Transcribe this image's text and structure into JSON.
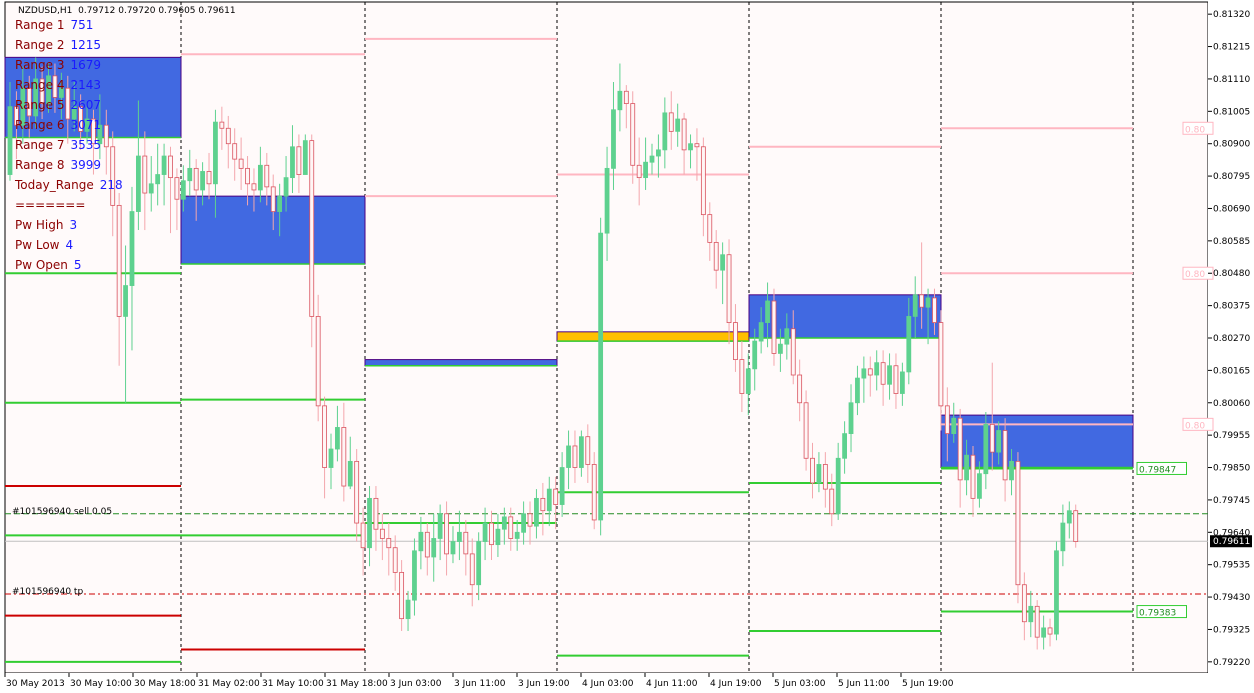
{
  "header": {
    "symbol": "NZDUSD,H1",
    "ohlc": "0.79712 0.79720 0.79605 0.79611"
  },
  "info_panel": {
    "rows": [
      {
        "label": "Range 1",
        "value": "751"
      },
      {
        "label": "Range 2",
        "value": "1215"
      },
      {
        "label": "Range 3",
        "value": "1679"
      },
      {
        "label": "Range 4",
        "value": "2143"
      },
      {
        "label": "Range 5",
        "value": "2607"
      },
      {
        "label": "Range 6",
        "value": "3071"
      },
      {
        "label": "Range 7",
        "value": "3535"
      },
      {
        "label": "Range 8",
        "value": "3999"
      },
      {
        "label": "Today_Range",
        "value": "218"
      },
      {
        "label": "=======",
        "value": ""
      },
      {
        "label": "Pw High",
        "value": "3"
      },
      {
        "label": "Pw Low",
        "value": "4"
      },
      {
        "label": "Pw Open",
        "value": "5"
      }
    ]
  },
  "orders": {
    "sell_label": "#101596940 sell 0.05",
    "tp_label": "#101596940 tp"
  },
  "colors": {
    "bull": "#5ed18f",
    "bear": "#f4a6ac",
    "zone": "#4169e1",
    "zone_highlight": "#ffc000",
    "support": "#32cd32",
    "resistance": "#ffb6c1",
    "tp": "#cc0000",
    "background": "#fffafa"
  },
  "chart_data": {
    "type": "candlestick",
    "symbol": "NZDUSD",
    "timeframe": "H1",
    "y_ticks": [
      "0.81320",
      "0.81215",
      "0.81110",
      "0.81005",
      "0.80900",
      "0.80795",
      "0.80690",
      "0.80585",
      "0.80480",
      "0.80375",
      "0.80270",
      "0.80165",
      "0.80060",
      "0.79955",
      "0.79850",
      "0.79745",
      "0.79640",
      "0.79535",
      "0.79430",
      "0.79325",
      "0.79220"
    ],
    "x_ticks": [
      "30 May 2013",
      "30 May 10:00",
      "30 May 18:00",
      "31 May 02:00",
      "31 May 10:00",
      "31 May 18:00",
      "3 Jun 03:00",
      "3 Jun 11:00",
      "3 Jun 19:00",
      "4 Jun 03:00",
      "4 Jun 11:00",
      "4 Jun 19:00",
      "5 Jun 03:00",
      "5 Jun 11:00",
      "5 Jun 19:00"
    ],
    "ylim": [
      0.792,
      0.8134
    ],
    "current_price": "0.79611",
    "price_tags": [
      {
        "text": "0.80",
        "price": 0.8095
      },
      {
        "text": "0.80",
        "price": 0.8048
      },
      {
        "text": "0.80",
        "price": 0.7999
      },
      {
        "text": "0.79847",
        "price": 0.79847
      },
      {
        "text": "0.79383",
        "price": 0.79383
      }
    ],
    "zones": [
      {
        "day": 0,
        "top": 0.8118,
        "bottom": 0.8092,
        "color": "zone"
      },
      {
        "day": 1,
        "top": 0.8073,
        "bottom": 0.8051,
        "color": "zone"
      },
      {
        "day": 2,
        "top": 0.802,
        "bottom": 0.8018,
        "color": "zone"
      },
      {
        "day": 3,
        "top": 0.8029,
        "bottom": 0.8026,
        "color": "zone_highlight"
      },
      {
        "day": 4,
        "top": 0.8041,
        "bottom": 0.8027,
        "color": "zone"
      },
      {
        "day": 5,
        "top": 0.8002,
        "bottom": 0.7985,
        "color": "zone"
      }
    ],
    "green_levels": [
      {
        "day": 0,
        "prices": [
          0.8048,
          0.8006,
          0.7963,
          0.7922
        ]
      },
      {
        "day": 1,
        "prices": [
          0.8007,
          0.7963
        ]
      },
      {
        "day": 2,
        "prices": [
          0.7967
        ]
      },
      {
        "day": 3,
        "prices": [
          0.7977,
          0.7924
        ]
      },
      {
        "day": 4,
        "prices": [
          0.798,
          0.7932
        ]
      },
      {
        "day": 5,
        "prices": [
          0.79847,
          0.79383
        ]
      }
    ],
    "pink_levels": [
      {
        "day": 1,
        "prices": [
          0.8119
        ]
      },
      {
        "day": 2,
        "prices": [
          0.8124,
          0.8073
        ]
      },
      {
        "day": 3,
        "prices": [
          0.808
        ]
      },
      {
        "day": 4,
        "prices": [
          0.8089
        ]
      },
      {
        "day": 5,
        "prices": [
          0.8095,
          0.8048,
          0.7999
        ]
      }
    ],
    "red_levels": [
      {
        "day": 0,
        "prices": [
          0.7979,
          0.7937
        ]
      },
      {
        "day": 1,
        "prices": [
          0.7926
        ]
      }
    ],
    "order_levels": {
      "sell": 0.797,
      "tp": 0.7944
    },
    "candles": [
      [
        0.808,
        0.8102,
        0.811,
        0.8078
      ],
      [
        0.8102,
        0.8096,
        0.8107,
        0.8085
      ],
      [
        0.8096,
        0.8108,
        0.8115,
        0.809
      ],
      [
        0.8108,
        0.8099,
        0.8112,
        0.8092
      ],
      [
        0.8099,
        0.8111,
        0.8118,
        0.8095
      ],
      [
        0.8111,
        0.8103,
        0.8115,
        0.8098
      ],
      [
        0.8103,
        0.8112,
        0.8116,
        0.81
      ],
      [
        0.8112,
        0.8105,
        0.8116,
        0.81
      ],
      [
        0.8105,
        0.8108,
        0.8113,
        0.8098
      ],
      [
        0.8108,
        0.8098,
        0.8112,
        0.809
      ],
      [
        0.8098,
        0.8102,
        0.811,
        0.8094
      ],
      [
        0.8102,
        0.8094,
        0.8106,
        0.8088
      ],
      [
        0.8094,
        0.8098,
        0.8103,
        0.809
      ],
      [
        0.8098,
        0.809,
        0.8101,
        0.808
      ],
      [
        0.809,
        0.8096,
        0.8106,
        0.8085
      ],
      [
        0.8096,
        0.8089,
        0.8101,
        0.808
      ],
      [
        0.8089,
        0.807,
        0.8094,
        0.806
      ],
      [
        0.807,
        0.8034,
        0.8074,
        0.8018
      ],
      [
        0.8034,
        0.8044,
        0.8057,
        0.8006
      ],
      [
        0.8044,
        0.8068,
        0.8076,
        0.8023
      ],
      [
        0.8068,
        0.8086,
        0.8104,
        0.8062
      ],
      [
        0.8086,
        0.8074,
        0.8094,
        0.8062
      ],
      [
        0.8074,
        0.8077,
        0.8086,
        0.8068
      ],
      [
        0.8077,
        0.808,
        0.809,
        0.807
      ],
      [
        0.808,
        0.8086,
        0.809,
        0.807
      ],
      [
        0.8086,
        0.8079,
        0.8089,
        0.8061
      ],
      [
        0.8079,
        0.8072,
        0.8082,
        0.8062
      ],
      [
        0.8072,
        0.8078,
        0.8083,
        0.8068
      ],
      [
        0.8078,
        0.8082,
        0.8088,
        0.8073
      ],
      [
        0.8082,
        0.8075,
        0.8085,
        0.8065
      ],
      [
        0.8075,
        0.8081,
        0.8084,
        0.807
      ],
      [
        0.8081,
        0.8077,
        0.8087,
        0.8072
      ],
      [
        0.8077,
        0.8097,
        0.8101,
        0.8066
      ],
      [
        0.8097,
        0.8095,
        0.8102,
        0.8088
      ],
      [
        0.8095,
        0.809,
        0.8099,
        0.8082
      ],
      [
        0.809,
        0.8085,
        0.8095,
        0.8078
      ],
      [
        0.8085,
        0.8082,
        0.8092,
        0.8075
      ],
      [
        0.8082,
        0.8077,
        0.8086,
        0.807
      ],
      [
        0.8077,
        0.8075,
        0.8082,
        0.8068
      ],
      [
        0.8075,
        0.8083,
        0.8089,
        0.8071
      ],
      [
        0.8083,
        0.8076,
        0.8087,
        0.807
      ],
      [
        0.8076,
        0.8068,
        0.808,
        0.8062
      ],
      [
        0.8068,
        0.8073,
        0.8077,
        0.806
      ],
      [
        0.8073,
        0.8079,
        0.8086,
        0.8068
      ],
      [
        0.8079,
        0.8089,
        0.8096,
        0.8074
      ],
      [
        0.8089,
        0.808,
        0.8093,
        0.8074
      ],
      [
        0.808,
        0.8091,
        0.8093,
        0.8082
      ],
      [
        0.8091,
        0.8034,
        0.8093,
        0.8024
      ],
      [
        0.8034,
        0.8005,
        0.8041,
        0.8
      ],
      [
        0.8005,
        0.7985,
        0.8008,
        0.7975
      ],
      [
        0.7985,
        0.7991,
        0.7996,
        0.7978
      ],
      [
        0.7991,
        0.7998,
        0.8005,
        0.7987
      ],
      [
        0.7998,
        0.7979,
        0.8006,
        0.7974
      ],
      [
        0.7979,
        0.7987,
        0.7995,
        0.7978
      ],
      [
        0.7987,
        0.7967,
        0.7991,
        0.7961
      ],
      [
        0.7967,
        0.7959,
        0.7972,
        0.795
      ],
      [
        0.7959,
        0.7975,
        0.7979,
        0.7953
      ],
      [
        0.7975,
        0.7965,
        0.7979,
        0.7958
      ],
      [
        0.7965,
        0.7962,
        0.797,
        0.7955
      ],
      [
        0.7962,
        0.7959,
        0.7967,
        0.795
      ],
      [
        0.7959,
        0.7951,
        0.7963,
        0.7945
      ],
      [
        0.7951,
        0.7936,
        0.7955,
        0.7932
      ],
      [
        0.7936,
        0.7942,
        0.7945,
        0.7932
      ],
      [
        0.7942,
        0.7958,
        0.7962,
        0.7937
      ],
      [
        0.7958,
        0.7964,
        0.7969,
        0.7952
      ],
      [
        0.7964,
        0.7956,
        0.7967,
        0.795
      ],
      [
        0.7956,
        0.7962,
        0.797,
        0.7948
      ],
      [
        0.7962,
        0.797,
        0.7973,
        0.7955
      ],
      [
        0.797,
        0.7957,
        0.7974,
        0.795
      ],
      [
        0.7957,
        0.7961,
        0.7966,
        0.7954
      ],
      [
        0.7961,
        0.7964,
        0.7971,
        0.7955
      ],
      [
        0.7964,
        0.7957,
        0.7968,
        0.795
      ],
      [
        0.7957,
        0.7947,
        0.7962,
        0.794
      ],
      [
        0.7947,
        0.7961,
        0.7964,
        0.7942
      ],
      [
        0.7961,
        0.7967,
        0.7972,
        0.7955
      ],
      [
        0.7967,
        0.796,
        0.7971,
        0.7955
      ],
      [
        0.796,
        0.7965,
        0.797,
        0.7956
      ],
      [
        0.7965,
        0.7969,
        0.7972,
        0.796
      ],
      [
        0.7969,
        0.7962,
        0.7972,
        0.7958
      ],
      [
        0.7962,
        0.7964,
        0.7968,
        0.7958
      ],
      [
        0.7964,
        0.797,
        0.7974,
        0.796
      ],
      [
        0.797,
        0.7966,
        0.7974,
        0.796
      ],
      [
        0.7966,
        0.7975,
        0.7978,
        0.7962
      ],
      [
        0.7975,
        0.7971,
        0.798,
        0.7963
      ],
      [
        0.7971,
        0.7978,
        0.7982,
        0.7966
      ],
      [
        0.7978,
        0.7973,
        0.7982,
        0.7965
      ],
      [
        0.7973,
        0.7985,
        0.799,
        0.7969
      ],
      [
        0.7985,
        0.7992,
        0.7997,
        0.7978
      ],
      [
        0.7992,
        0.7985,
        0.7997,
        0.798
      ],
      [
        0.7985,
        0.7995,
        0.7997,
        0.7982
      ],
      [
        0.7995,
        0.7986,
        0.7999,
        0.798
      ],
      [
        0.7986,
        0.7968,
        0.799,
        0.7965
      ],
      [
        0.7968,
        0.8061,
        0.8066,
        0.7963
      ],
      [
        0.8061,
        0.8082,
        0.8089,
        0.8052
      ],
      [
        0.8082,
        0.8101,
        0.811,
        0.8075
      ],
      [
        0.8101,
        0.8107,
        0.8116,
        0.8094
      ],
      [
        0.8107,
        0.8103,
        0.8109,
        0.8095
      ],
      [
        0.8103,
        0.8083,
        0.8107,
        0.8077
      ],
      [
        0.8083,
        0.8079,
        0.8092,
        0.807
      ],
      [
        0.8079,
        0.8084,
        0.8092,
        0.8075
      ],
      [
        0.8084,
        0.8086,
        0.809,
        0.808
      ],
      [
        0.8086,
        0.8088,
        0.8093,
        0.8079
      ],
      [
        0.8088,
        0.81,
        0.8105,
        0.8082
      ],
      [
        0.81,
        0.8094,
        0.8107,
        0.8088
      ],
      [
        0.8094,
        0.8098,
        0.8103,
        0.8089
      ],
      [
        0.8098,
        0.8088,
        0.81,
        0.808
      ],
      [
        0.8088,
        0.809,
        0.8093,
        0.8082
      ],
      [
        0.809,
        0.8089,
        0.8095,
        0.8078
      ],
      [
        0.8089,
        0.8067,
        0.8092,
        0.806
      ],
      [
        0.8067,
        0.8058,
        0.8071,
        0.8052
      ],
      [
        0.8058,
        0.8049,
        0.8062,
        0.8043
      ],
      [
        0.8049,
        0.8054,
        0.8058,
        0.8038
      ],
      [
        0.8054,
        0.8032,
        0.8059,
        0.8025
      ],
      [
        0.8032,
        0.802,
        0.8038,
        0.8016
      ],
      [
        0.802,
        0.8009,
        0.8026,
        0.8003
      ],
      [
        0.8009,
        0.8017,
        0.8022,
        0.8002
      ],
      [
        0.8017,
        0.8026,
        0.803,
        0.801
      ],
      [
        0.8026,
        0.8032,
        0.8037,
        0.8022
      ],
      [
        0.8032,
        0.8039,
        0.8045,
        0.8024
      ],
      [
        0.8039,
        0.8022,
        0.8043,
        0.8018
      ],
      [
        0.8022,
        0.8025,
        0.803,
        0.8016
      ],
      [
        0.8025,
        0.803,
        0.8035,
        0.802
      ],
      [
        0.803,
        0.8015,
        0.8036,
        0.8012
      ],
      [
        0.8015,
        0.8006,
        0.802,
        0.8
      ],
      [
        0.8006,
        0.7988,
        0.801,
        0.7984
      ],
      [
        0.7988,
        0.798,
        0.7993,
        0.7975
      ],
      [
        0.798,
        0.7986,
        0.799,
        0.7977
      ],
      [
        0.7986,
        0.7978,
        0.799,
        0.7972
      ],
      [
        0.7978,
        0.797,
        0.7983,
        0.7966
      ],
      [
        0.797,
        0.7988,
        0.7993,
        0.7968
      ],
      [
        0.7988,
        0.7996,
        0.8,
        0.7983
      ],
      [
        0.7996,
        0.8006,
        0.8012,
        0.799
      ],
      [
        0.8006,
        0.8014,
        0.8018,
        0.8002
      ],
      [
        0.8014,
        0.8017,
        0.8021,
        0.8006
      ],
      [
        0.8017,
        0.8015,
        0.8021,
        0.8008
      ],
      [
        0.8015,
        0.8019,
        0.8023,
        0.801
      ],
      [
        0.8019,
        0.8012,
        0.8023,
        0.8005
      ],
      [
        0.8012,
        0.8018,
        0.8022,
        0.8007
      ],
      [
        0.8018,
        0.8009,
        0.8022,
        0.8004
      ],
      [
        0.8009,
        0.8016,
        0.8019,
        0.8005
      ],
      [
        0.8016,
        0.8034,
        0.804,
        0.8012
      ],
      [
        0.8034,
        0.8041,
        0.8047,
        0.8027
      ],
      [
        0.8041,
        0.8037,
        0.8058,
        0.803
      ],
      [
        0.8037,
        0.804,
        0.8043,
        0.8025
      ],
      [
        0.804,
        0.8032,
        0.8043,
        0.8028
      ],
      [
        0.8032,
        0.8005,
        0.8036,
        0.7997
      ],
      [
        0.8005,
        0.7996,
        0.8011,
        0.7987
      ],
      [
        0.7996,
        0.8001,
        0.8006,
        0.7993
      ],
      [
        0.8001,
        0.7981,
        0.8004,
        0.7972
      ],
      [
        0.7981,
        0.7989,
        0.7994,
        0.7976
      ],
      [
        0.7989,
        0.7975,
        0.7992,
        0.7969
      ],
      [
        0.7975,
        0.7983,
        0.7987,
        0.7972
      ],
      [
        0.7983,
        0.7999,
        0.8003,
        0.7978
      ],
      [
        0.7999,
        0.799,
        0.8019,
        0.7984
      ],
      [
        0.799,
        0.7997,
        0.8,
        0.7986
      ],
      [
        0.7997,
        0.7981,
        0.8001,
        0.7974
      ],
      [
        0.7981,
        0.7987,
        0.7991,
        0.7976
      ],
      [
        0.7987,
        0.7947,
        0.799,
        0.7941
      ],
      [
        0.7947,
        0.7935,
        0.7951,
        0.7929
      ],
      [
        0.7935,
        0.794,
        0.7945,
        0.793
      ],
      [
        0.794,
        0.793,
        0.7942,
        0.7926
      ],
      [
        0.793,
        0.7933,
        0.7937,
        0.7926
      ],
      [
        0.7933,
        0.7931,
        0.7936,
        0.7927
      ],
      [
        0.7931,
        0.7958,
        0.7961,
        0.7929
      ],
      [
        0.7958,
        0.7967,
        0.7973,
        0.7953
      ],
      [
        0.7967,
        0.7971,
        0.7974,
        0.7962
      ],
      [
        0.7971,
        0.7961,
        0.7973,
        0.7959
      ]
    ]
  }
}
